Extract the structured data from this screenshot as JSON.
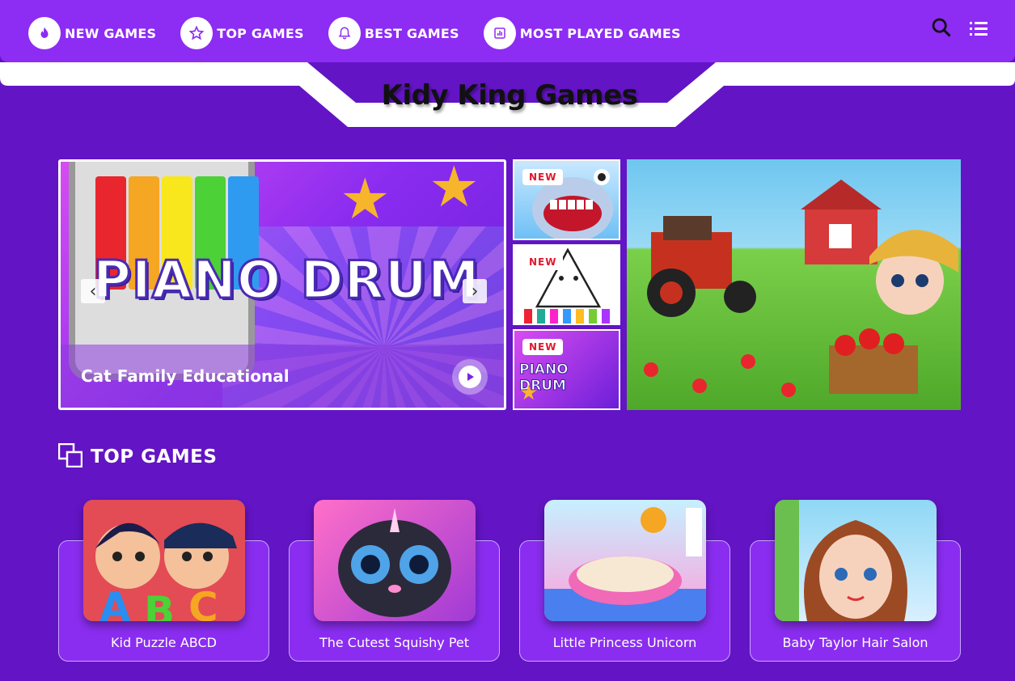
{
  "header": {
    "nav": [
      {
        "label": "NEW GAMES",
        "icon": "fire-icon"
      },
      {
        "label": "TOP GAMES",
        "icon": "star-icon"
      },
      {
        "label": "BEST GAMES",
        "icon": "bell-icon"
      },
      {
        "label": "MOST PLAYED GAMES",
        "icon": "chart-icon"
      }
    ],
    "logo": "Kidy King Games"
  },
  "hero": {
    "slide_title": "PIANO DRUM",
    "caption": "Cat Family Educational",
    "thumb_badges": [
      "NEW",
      "NEW",
      "NEW"
    ],
    "thumb3_text": "PIANO DRUM"
  },
  "top_games": {
    "title": "TOP GAMES",
    "items": [
      {
        "name": "Kid Puzzle ABCD"
      },
      {
        "name": "The Cutest Squishy Pet"
      },
      {
        "name": "Little Princess Unicorn"
      },
      {
        "name": "Baby Taylor Hair Salon"
      }
    ]
  },
  "colors": {
    "bg": "#6314c4",
    "bar": "#8d2cf3",
    "badge": "#e0182d"
  }
}
